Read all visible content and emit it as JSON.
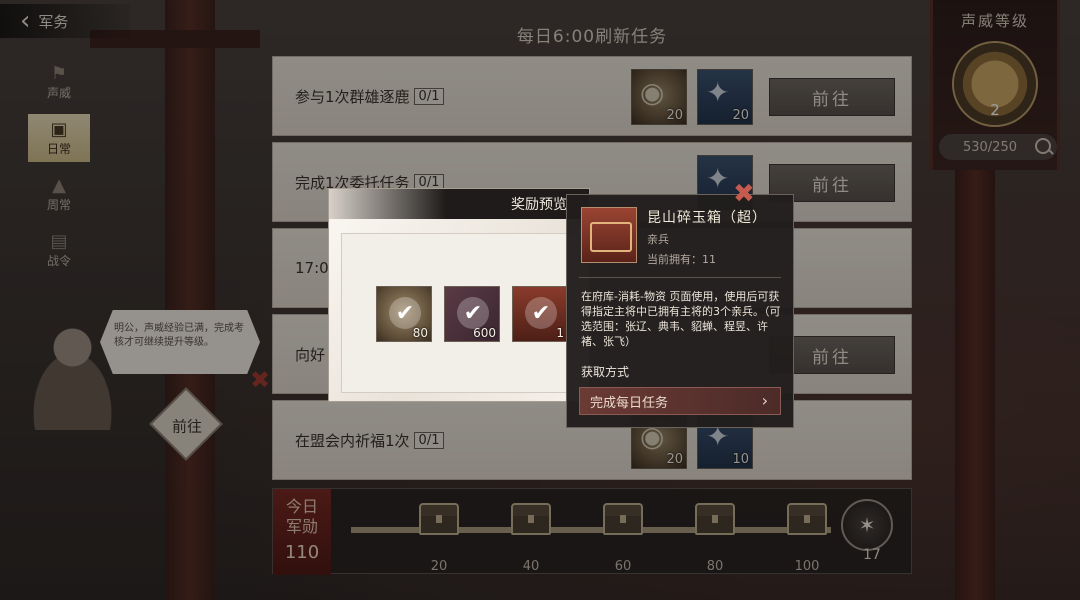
{
  "nav": {
    "back_label": "军务"
  },
  "side_tabs": [
    {
      "label": "声威",
      "icon": "banner-icon"
    },
    {
      "label": "日常",
      "icon": "chest-icon"
    },
    {
      "label": "周常",
      "icon": "helmet-icon"
    },
    {
      "label": "战令",
      "icon": "scroll-icon"
    }
  ],
  "header": {
    "title": "每日6:00刷新任务"
  },
  "tasks": [
    {
      "text": "参与1次群雄逐鹿",
      "count": "0/1",
      "button": "前往",
      "rewards": [
        {
          "type": "coin",
          "qty": "20"
        },
        {
          "type": "flag",
          "qty": "20"
        }
      ]
    },
    {
      "text": "完成1次委托任务",
      "count": "0/1",
      "button": "前往"
    },
    {
      "text": "17:00"
    },
    {
      "text": "向好",
      "button": "前往"
    },
    {
      "text": "在盟会内祈福1次",
      "count": "0/1",
      "rewards": [
        {
          "type": "coin",
          "qty": "20"
        },
        {
          "type": "flag",
          "qty": "10"
        }
      ]
    }
  ],
  "progress": {
    "label_line1": "今日",
    "label_line2": "军勋",
    "value": "110",
    "milestones": [
      "20",
      "40",
      "60",
      "80",
      "100"
    ],
    "final_count": "17"
  },
  "prestige": {
    "title": "声威等级",
    "level": "2",
    "exp": "530/250"
  },
  "advisor": {
    "speech": "明公，声威经验已满，完成考核才可继续提升等级。",
    "go_label": "前往"
  },
  "reward_modal": {
    "title": "奖励预览",
    "items": [
      {
        "type": "coin",
        "qty": "80"
      },
      {
        "type": "scroll",
        "qty": "600"
      },
      {
        "type": "box",
        "qty": "1"
      }
    ]
  },
  "tooltip": {
    "name": "昆山碎玉箱（超）",
    "type": "亲兵",
    "owned": "当前拥有：11",
    "description": "在府库-消耗-物资 页面使用，使用后可获得指定主将中已拥有主将的3个亲兵。（可选范围：张辽、典韦、貂蝉、程昱、许褚、张飞）",
    "obtain_label": "获取方式",
    "source": "完成每日任务"
  },
  "colors": {
    "accent_red": "#7a2a24",
    "panel_light": "#e8e2d8",
    "button_gray": "#6e6761"
  }
}
